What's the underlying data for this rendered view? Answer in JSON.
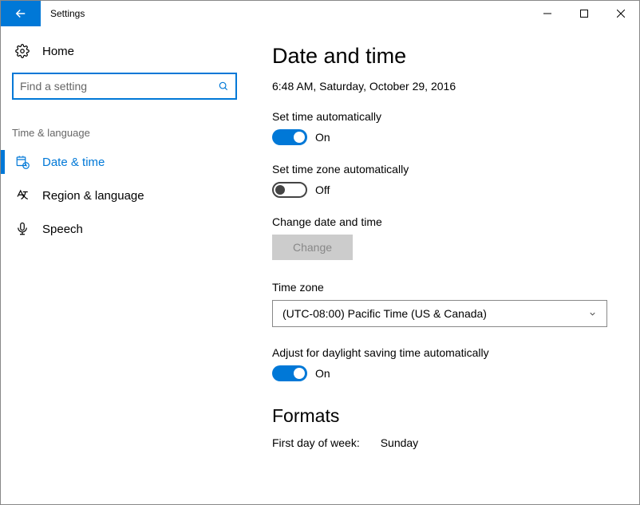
{
  "window": {
    "title": "Settings"
  },
  "sidebar": {
    "home": "Home",
    "search_placeholder": "Find a setting",
    "category": "Time & language",
    "items": [
      {
        "label": "Date & time"
      },
      {
        "label": "Region & language"
      },
      {
        "label": "Speech"
      }
    ]
  },
  "main": {
    "heading": "Date and time",
    "now": "6:48 AM, Saturday, October 29, 2016",
    "auto_time": {
      "label": "Set time automatically",
      "state": "On"
    },
    "auto_tz": {
      "label": "Set time zone automatically",
      "state": "Off"
    },
    "change": {
      "label": "Change date and time",
      "button": "Change"
    },
    "tz": {
      "label": "Time zone",
      "value": "(UTC-08:00) Pacific Time (US & Canada)"
    },
    "dst": {
      "label": "Adjust for daylight saving time automatically",
      "state": "On"
    },
    "formats": {
      "heading": "Formats",
      "first_day_label": "First day of week:",
      "first_day_value": "Sunday"
    }
  }
}
